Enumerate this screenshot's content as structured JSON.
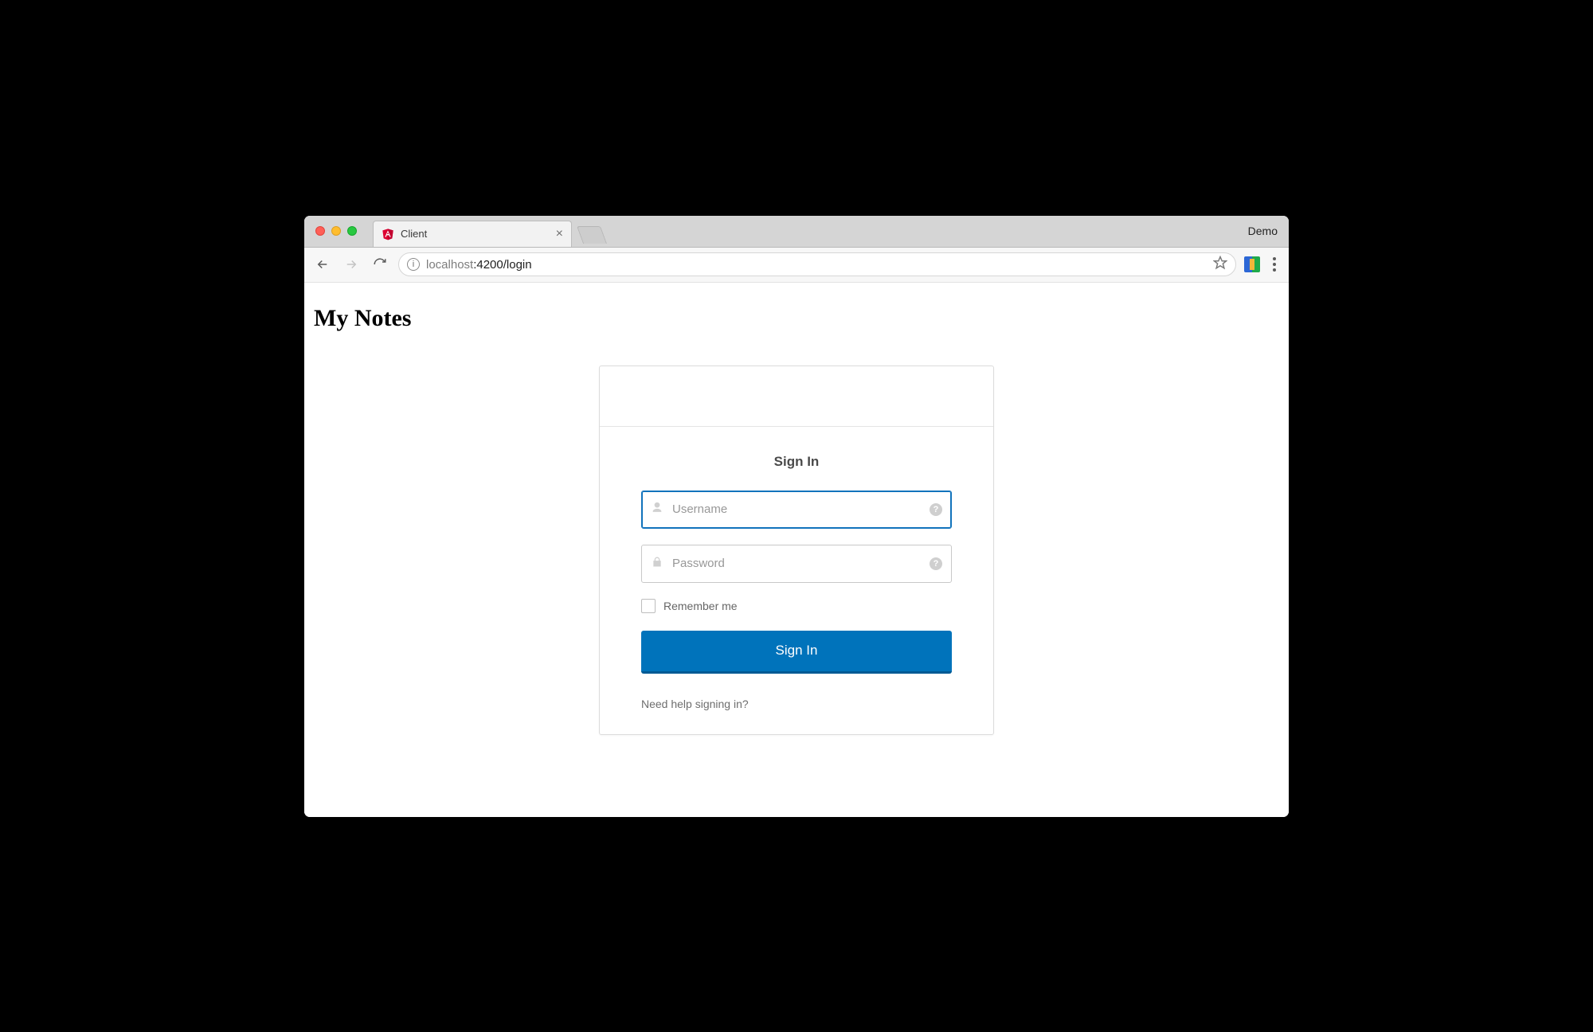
{
  "browser": {
    "tab_title": "Client",
    "demo_label": "Demo",
    "favicon": "angular-icon",
    "url_display": {
      "prefix": "localhost",
      "port_path": ":4200/login"
    }
  },
  "page": {
    "title": "My Notes"
  },
  "login": {
    "heading": "Sign In",
    "username": {
      "placeholder": "Username",
      "value": ""
    },
    "password": {
      "placeholder": "Password",
      "value": ""
    },
    "remember_label": "Remember me",
    "submit_label": "Sign In",
    "help_link": "Need help signing in?"
  }
}
